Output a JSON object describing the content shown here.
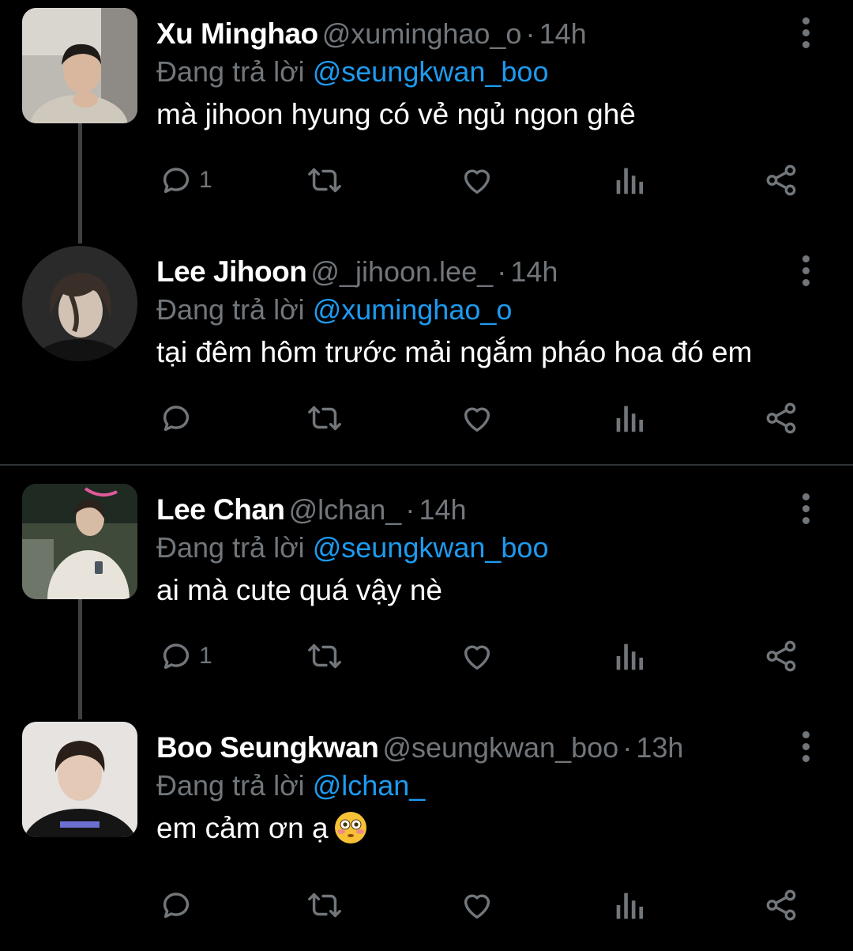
{
  "tweets": [
    {
      "name": "Xu Minghao",
      "handle": "@xuminghao_o",
      "time": "14h",
      "reply_prefix": "Đang trả lời",
      "reply_to": "@seungkwan_boo",
      "text": "mà jihoon hyung có vẻ ngủ ngon ghê",
      "reply_count": "1"
    },
    {
      "name": "Lee Jihoon",
      "handle": "@_jihoon.lee_",
      "time": "14h",
      "reply_prefix": "Đang trả lời",
      "reply_to": "@xuminghao_o",
      "text": "tại đêm hôm trước mải ngắm pháo hoa đó em",
      "reply_count": ""
    },
    {
      "name": "Lee Chan",
      "handle": "@lchan_",
      "time": "14h",
      "reply_prefix": "Đang trả lời",
      "reply_to": "@seungkwan_boo",
      "text": "ai mà cute quá vậy nè",
      "reply_count": "1"
    },
    {
      "name": "Boo Seungkwan",
      "handle": "@seungkwan_boo",
      "time": "13h",
      "reply_prefix": "Đang trả lời",
      "reply_to": "@lchan_",
      "text": "em cảm ơn ạ",
      "emoji": "flushed-face",
      "reply_count": ""
    }
  ],
  "separator": "·",
  "icons": [
    "reply-icon",
    "retweet-icon",
    "like-icon",
    "views-icon",
    "share-icon",
    "more-icon"
  ],
  "colors": {
    "background": "#000000",
    "name": "#ffffff",
    "muted": "#71767b",
    "mention": "#1d9bf0",
    "thread_line": "#3d4145"
  }
}
